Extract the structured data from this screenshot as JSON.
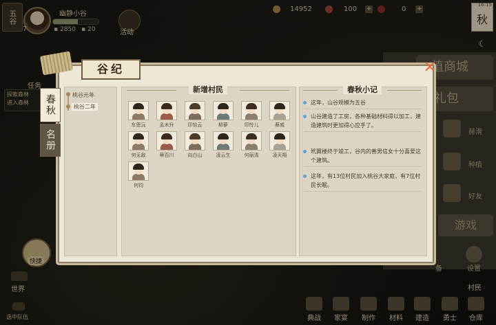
{
  "hud": {
    "village_badge": "五谷",
    "avatar_level": "7",
    "village_name": "幽静小谷",
    "progress_fraction": 0.55,
    "prosperity": "2850",
    "population": "20",
    "activity_label": "活动",
    "coins": "14952",
    "gems": "100",
    "tickets": "0",
    "clock": "16:15",
    "season": "秋"
  },
  "left_hud": {
    "task_label": "任务",
    "task_lines": [
      "探索森林",
      "进入森林"
    ],
    "tool_label": "快捷",
    "world_label": "世界",
    "chat_label": "选中队伍"
  },
  "side_menu": {
    "mall": "值商城",
    "gift": "礼包",
    "items": [
      "赫滑",
      "种植",
      "好友"
    ],
    "games": "游戏",
    "settings": "设置",
    "badge_extra": "备"
  },
  "bottom_bar": {
    "villager_label": "村民",
    "items": [
      "典战",
      "家宴",
      "制作",
      "材料",
      "建造",
      "勇士",
      "仓库"
    ]
  },
  "modal": {
    "title": "谷纪",
    "close": "✕",
    "tabs": [
      "春秋",
      "名册"
    ],
    "years": [
      "桃谷元年",
      "桃谷二年"
    ],
    "new_villagers_header": "新增村民",
    "notes_header": "春秋小记",
    "villagers": [
      "车恩沅",
      "孟木升",
      "印怡云",
      "柳萝",
      "印怜儿",
      "蔡威",
      "何无敌",
      "蒂百川",
      "向白山",
      "凌云生",
      "何丽清",
      "凌天翔",
      "何钧"
    ],
    "notes": [
      "这年，山谷规模为五谷",
      "山谷建造了工房，各种基础材料得以加工，建造建筑时更加得心应手了。",
      "玳翼楼终于竣工，谷内的善男信女十分喜爱这个建筑。",
      "这年，有13位村民加入桃谷大家庭，有7位村民长眠。"
    ]
  }
}
